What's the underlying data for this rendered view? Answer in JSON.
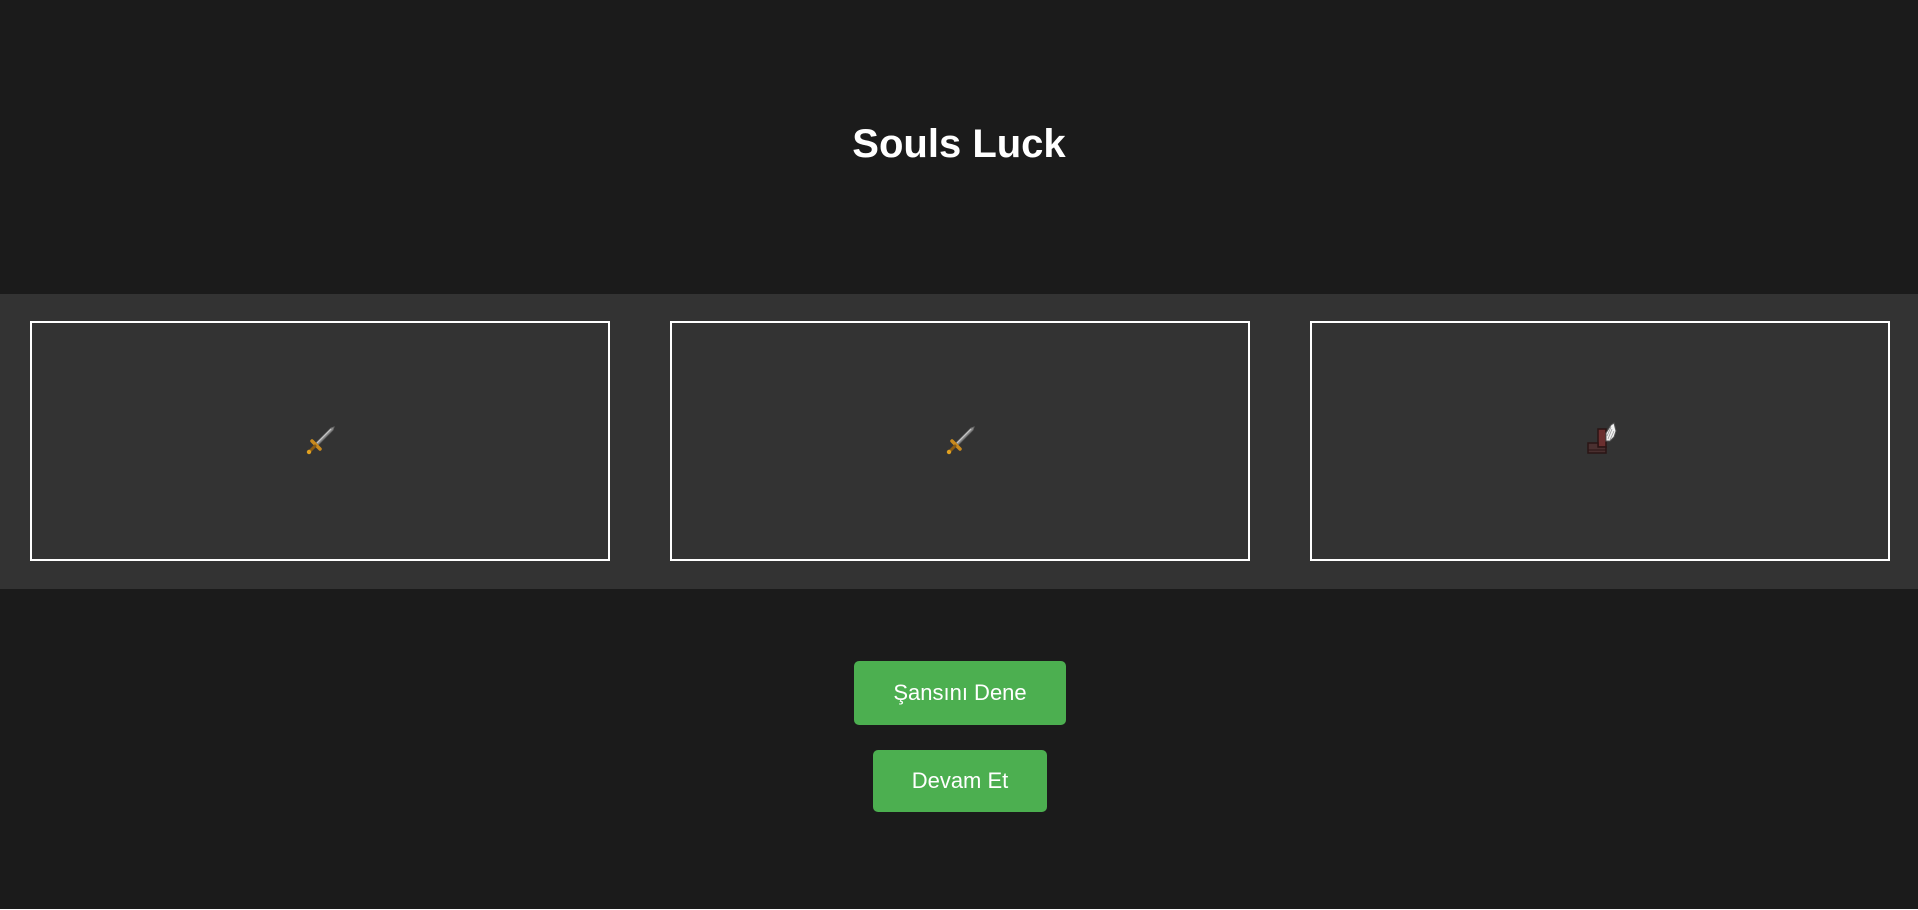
{
  "game": {
    "title": "Souls Luck"
  },
  "slots": [
    {
      "icon": "sword-icon"
    },
    {
      "icon": "sword-icon"
    },
    {
      "icon": "winged-boot-icon"
    }
  ],
  "buttons": {
    "try_luck_label": "Şansını Dene",
    "continue_label": "Devam Et"
  },
  "colors": {
    "background": "#1b1b1b",
    "slot_band": "#333333",
    "slot_border": "#ffffff",
    "button": "#4caf50",
    "text": "#ffffff"
  }
}
